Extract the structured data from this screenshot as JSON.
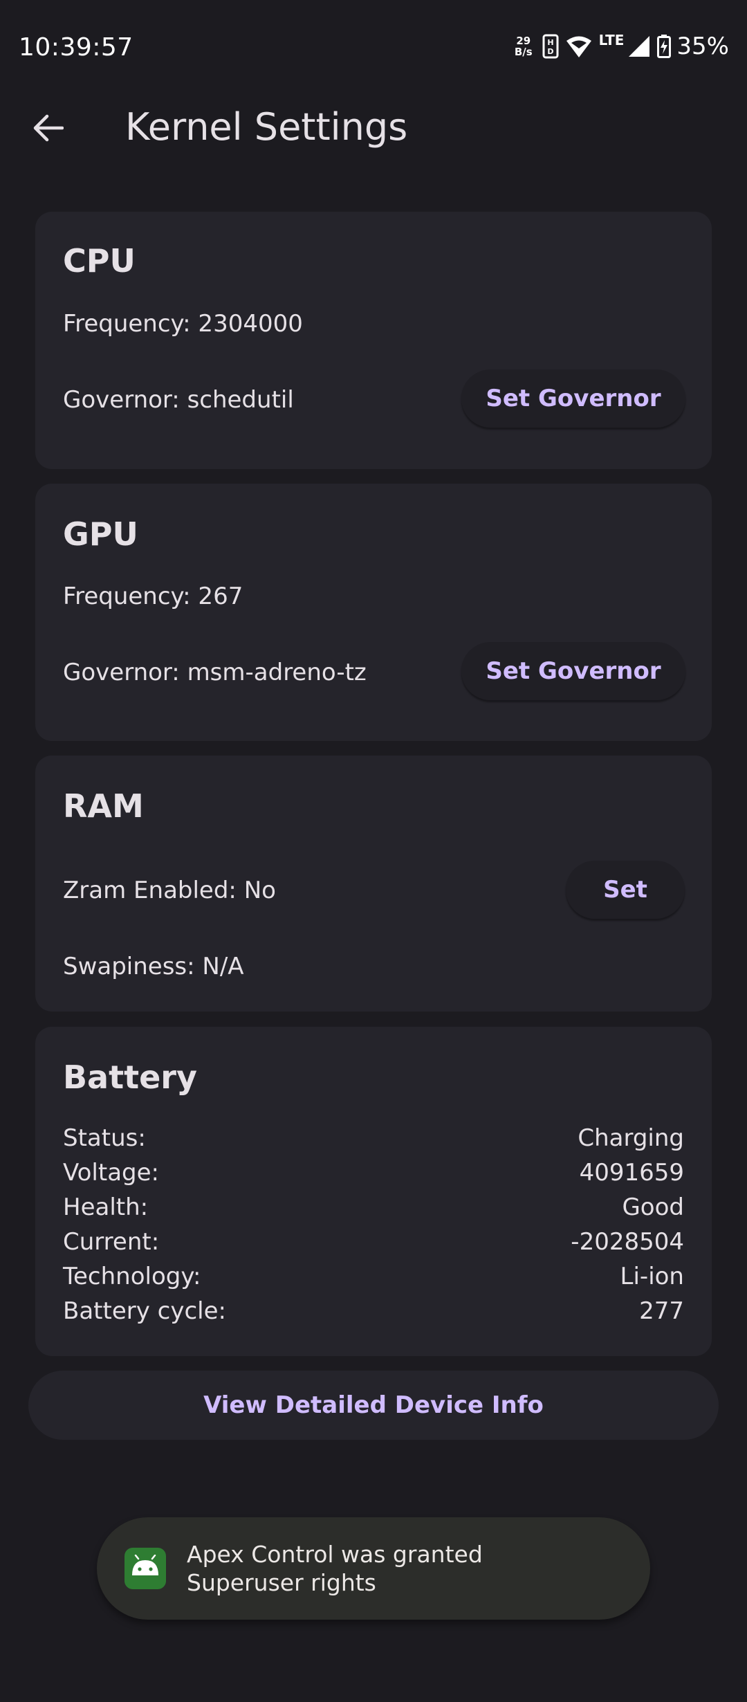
{
  "status_bar": {
    "time": "10:39:57",
    "net_speed_value": "29",
    "net_speed_unit": "B/s",
    "network_type": "LTE",
    "battery_percent": "35%",
    "icons": [
      "hd-voice-icon",
      "wifi-icon",
      "cell-signal-icon",
      "battery-charging-icon"
    ]
  },
  "app_bar": {
    "title": "Kernel Settings",
    "back_icon": "arrow-back-icon"
  },
  "cpu": {
    "title": "CPU",
    "frequency": "Frequency: 2304000",
    "governor": "Governor: schedutil",
    "button": "Set Governor"
  },
  "gpu": {
    "title": "GPU",
    "frequency": "Frequency: 267",
    "governor": "Governor: msm-adreno-tz",
    "button": "Set Governor"
  },
  "ram": {
    "title": "RAM",
    "zram": "Zram Enabled: No",
    "button": "Set",
    "swappiness": "Swapiness: N/A"
  },
  "battery": {
    "title": "Battery",
    "rows": [
      {
        "label": "Status:",
        "value": "Charging"
      },
      {
        "label": "Voltage:",
        "value": "4091659"
      },
      {
        "label": "Health:",
        "value": "Good"
      },
      {
        "label": "Current:",
        "value": "-2028504"
      },
      {
        "label": "Technology:",
        "value": "Li-ion"
      },
      {
        "label": "Battery cycle:",
        "value": "277"
      }
    ]
  },
  "detail_button": "View Detailed Device Info",
  "toast": {
    "icon": "android-icon",
    "message": "Apex Control was granted Superuser rights"
  },
  "colors": {
    "background": "#1c1b20",
    "card": "#25242b",
    "accent": "#d0bcff",
    "toast": "#2c2d2a"
  }
}
